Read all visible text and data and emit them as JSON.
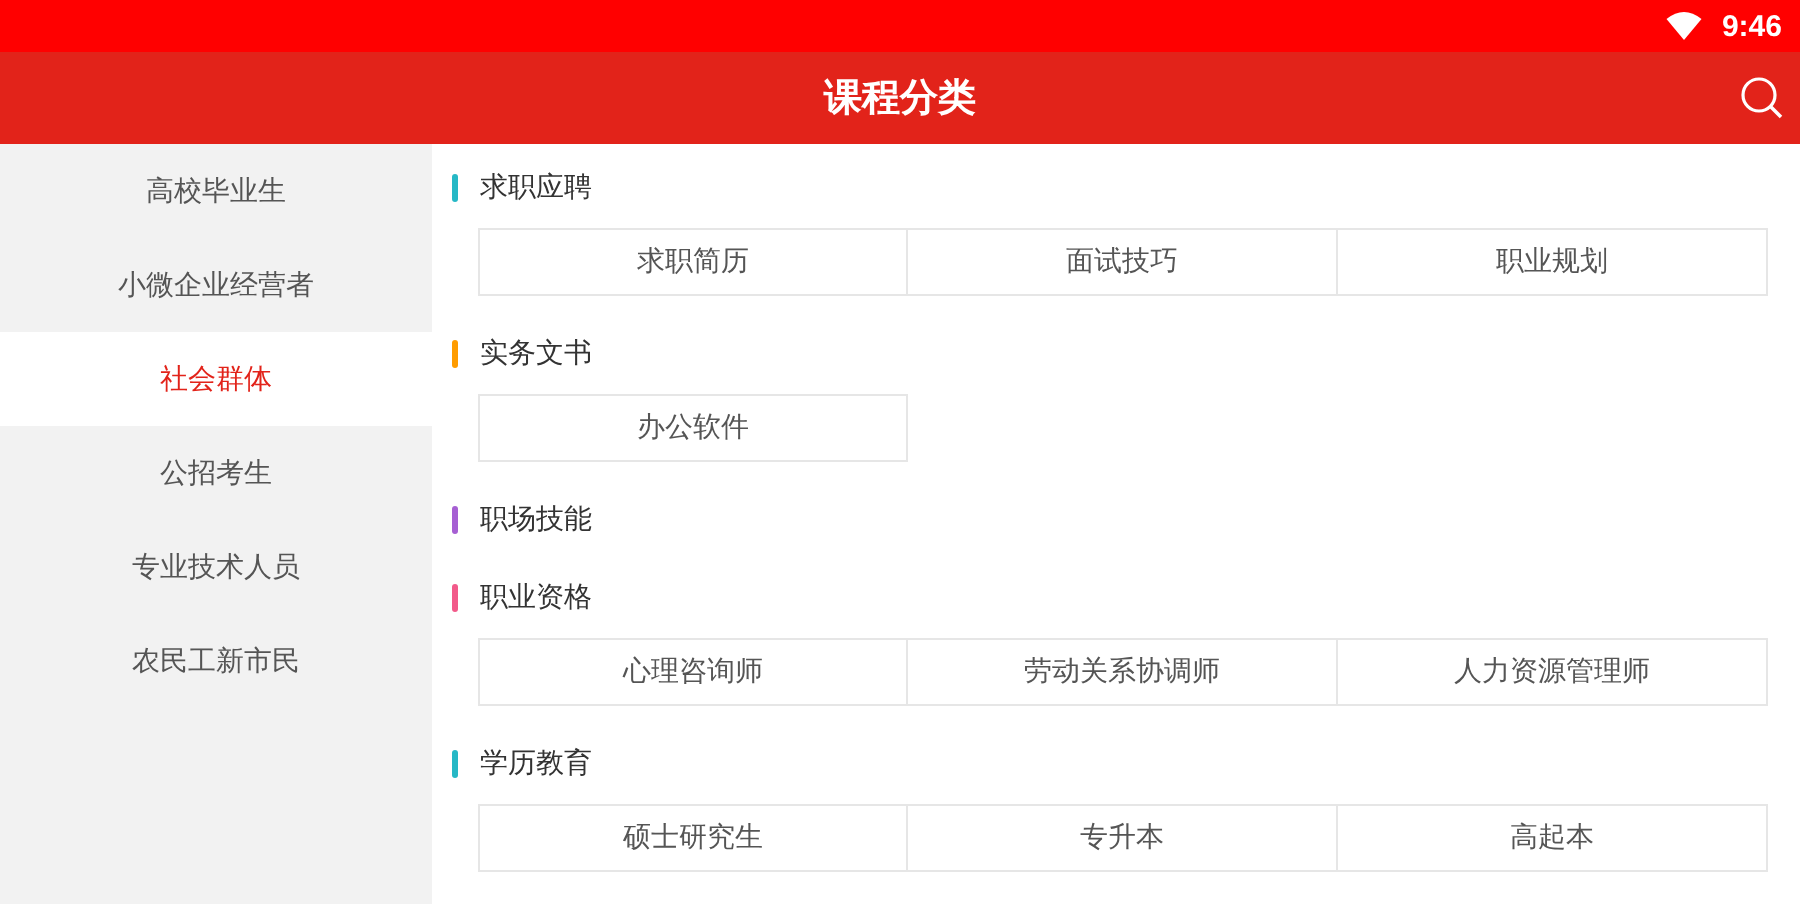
{
  "status_bar": {
    "time": "9:46"
  },
  "header": {
    "title": "课程分类"
  },
  "sidebar": {
    "items": [
      {
        "label": "高校毕业生",
        "selected": false
      },
      {
        "label": "小微企业经营者",
        "selected": false
      },
      {
        "label": "社会群体",
        "selected": true
      },
      {
        "label": "公招考生",
        "selected": false
      },
      {
        "label": "专业技术人员",
        "selected": false
      },
      {
        "label": "农民工新市民",
        "selected": false
      }
    ]
  },
  "sections": [
    {
      "title": "求职应聘",
      "color": "#26b8c6",
      "items": [
        "求职简历",
        "面试技巧",
        "职业规划"
      ]
    },
    {
      "title": "实务文书",
      "color": "#ff9c00",
      "items": [
        "办公软件"
      ]
    },
    {
      "title": "职场技能",
      "color": "#a65fd3"
    },
    {
      "title": "职业资格",
      "color": "#f25a8a",
      "items": [
        "心理咨询师",
        "劳动关系协调师",
        "人力资源管理师"
      ]
    },
    {
      "title": "学历教育",
      "color": "#26b8c6",
      "items": [
        "硕士研究生",
        "专升本",
        "高起本"
      ]
    }
  ]
}
